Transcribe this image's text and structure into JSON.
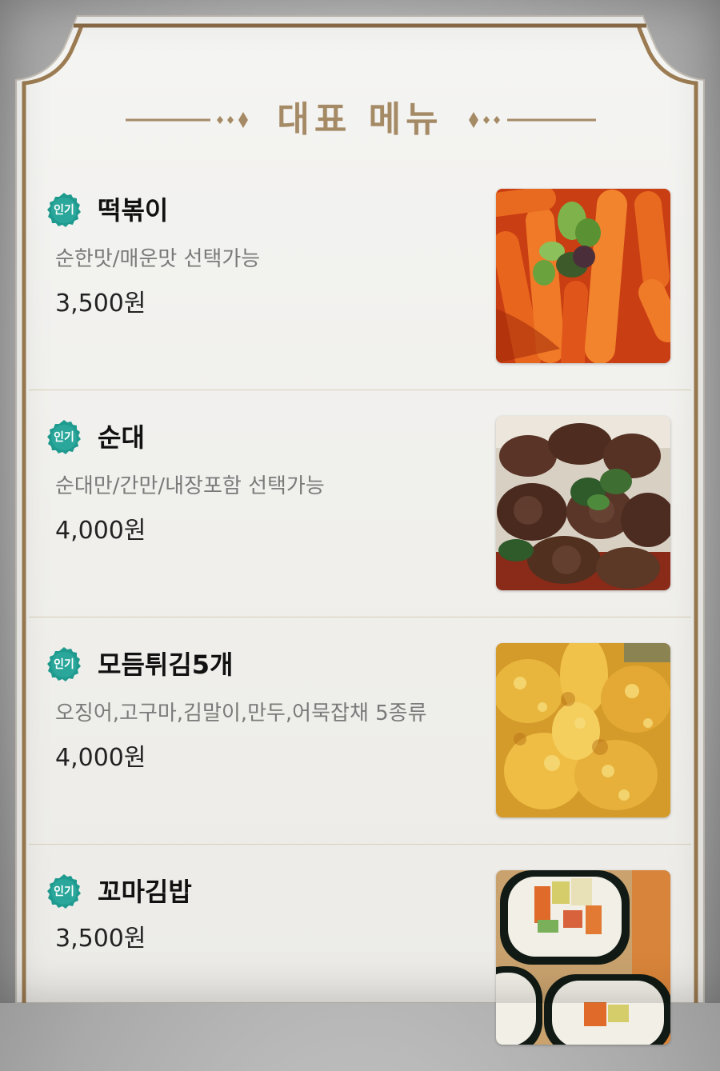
{
  "section": {
    "title": "대표 메뉴"
  },
  "items": [
    {
      "badge": "인기",
      "name": "떡볶이",
      "desc": "순한맛/매운맛 선택가능",
      "price": "3,500원",
      "photo_icon": "tteokbokki-photo"
    },
    {
      "badge": "인기",
      "name": "순대",
      "desc": "순대만/간만/내장포함  선택가능",
      "price": "4,000원",
      "photo_icon": "sundae-photo"
    },
    {
      "badge": "인기",
      "name": "모듬튀김5개",
      "desc": "오징어,고구마,김말이,만두,어묵잡채 5종류",
      "price": "4,000원",
      "photo_icon": "fried-assortment-photo"
    },
    {
      "badge": "인기",
      "name": "꼬마김밥",
      "price": "3,500원",
      "photo_icon": "mini-gimbap-photo"
    }
  ],
  "colors": {
    "gold": "#a58a66",
    "badge_teal": "#1f9a8e",
    "frame_brown": "#8a6c46"
  }
}
